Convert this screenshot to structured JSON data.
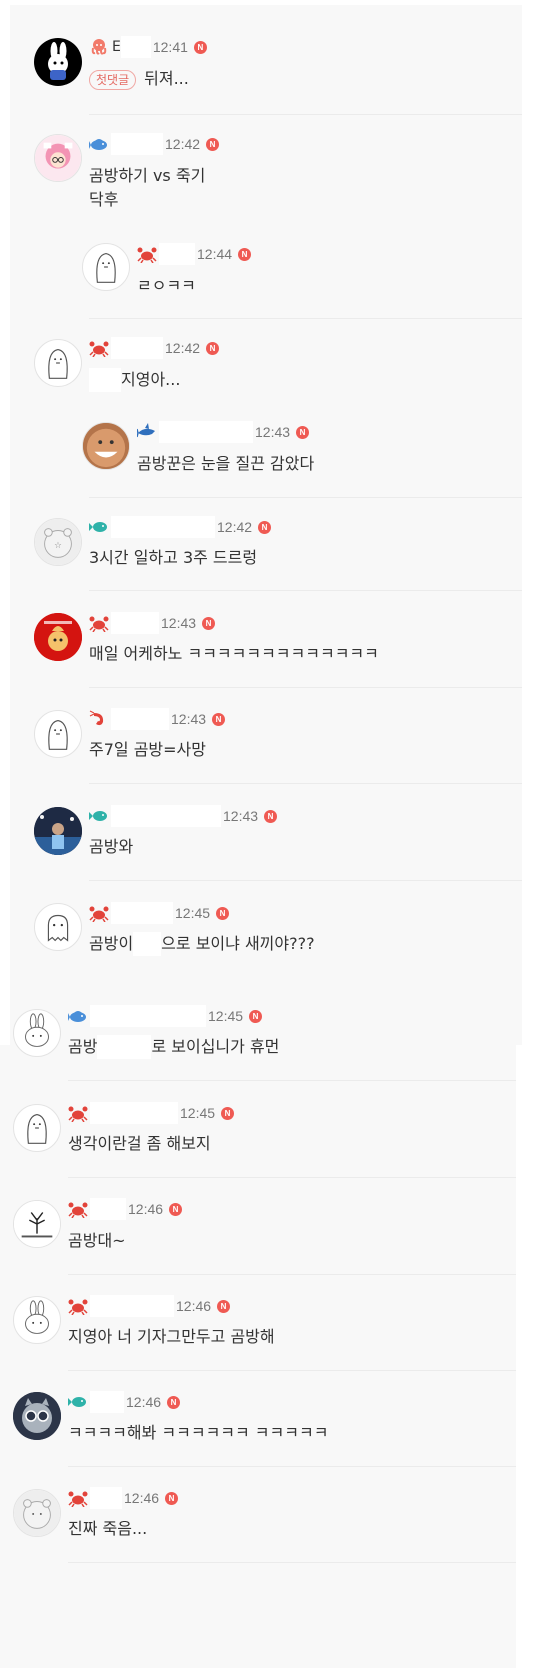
{
  "comments": [
    {
      "nick_fragment": "E",
      "time": "12:41",
      "badge": "N",
      "first_tag": "첫댓글",
      "text": "뒤져...",
      "level_icon": "octopus-icon"
    },
    {
      "time": "12:42",
      "badge": "N",
      "line1": "곰방하기 vs 죽기",
      "line2": "닥후",
      "level_icon": "fish-icon"
    },
    {
      "time": "12:44",
      "badge": "N",
      "text": "ㄹㅇㅋㅋ",
      "level_icon": "crab-icon"
    },
    {
      "time": "12:42",
      "badge": "N",
      "text": "지영아...",
      "level_icon": "crab-icon"
    },
    {
      "time": "12:43",
      "badge": "N",
      "text": "곰방꾼은 눈을 질끈 감았다",
      "level_icon": "shark-icon"
    },
    {
      "time": "12:42",
      "badge": "N",
      "text": "3시간 일하고 3주 드르렁",
      "level_icon": "fish-icon"
    },
    {
      "time": "12:43",
      "badge": "N",
      "text": "매일 어케하노 ㅋㅋㅋㅋㅋㅋㅋㅋㅋㅋㅋㅋㅋ",
      "level_icon": "crab-icon"
    },
    {
      "time": "12:43",
      "badge": "N",
      "text": "주7일 곰방=사망",
      "level_icon": "shrimp-icon"
    },
    {
      "time": "12:43",
      "badge": "N",
      "text": "곰방와",
      "level_icon": "fish-icon"
    },
    {
      "time": "12:45",
      "badge": "N",
      "text_a": "곰방이",
      "text_b": "으로 보이냐 새끼야???",
      "level_icon": "crab-icon"
    },
    {
      "time": "12:45",
      "badge": "N",
      "text_a": "곰방",
      "text_b": "로 보이십니가 휴먼",
      "level_icon": "fish-icon"
    },
    {
      "time": "12:45",
      "badge": "N",
      "text": "생각이란걸 좀 해보지",
      "level_icon": "crab-icon"
    },
    {
      "time": "12:46",
      "badge": "N",
      "text": "곰방대~",
      "level_icon": "crab-icon"
    },
    {
      "time": "12:46",
      "badge": "N",
      "text": "지영아 너 기자그만두고 곰방해",
      "level_icon": "crab-icon"
    },
    {
      "time": "12:46",
      "badge": "N",
      "text": "ㅋㅋㅋㅋ해봐 ㅋㅋㅋㅋㅋㅋ ㅋㅋㅋㅋㅋ",
      "level_icon": "fish-icon"
    },
    {
      "time": "12:46",
      "badge": "N",
      "text": "진짜 죽음...",
      "level_icon": "crab-icon"
    }
  ],
  "colors": {
    "panel_bg": "#f8f8f8",
    "new_badge": "#ef5a53",
    "first_tag": "#e46a63",
    "time_text": "#777777",
    "body_text": "#333333"
  }
}
